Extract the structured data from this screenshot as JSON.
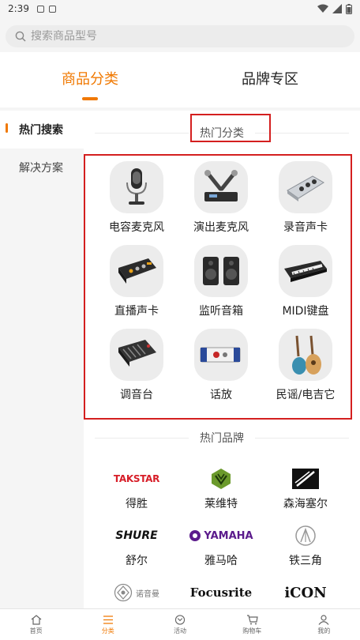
{
  "status_bar": {
    "time": "2:39"
  },
  "search": {
    "placeholder": "搜索商品型号"
  },
  "tabs": [
    {
      "label": "商品分类",
      "active": true
    },
    {
      "label": "品牌专区",
      "active": false
    }
  ],
  "sidebar": {
    "items": [
      {
        "label": "热门搜索",
        "active": true
      },
      {
        "label": "解决方案",
        "active": false
      }
    ]
  },
  "hot_categories": {
    "title": "热门分类",
    "items": [
      {
        "label": "电容麦克风",
        "icon": "condenser-mic-icon"
      },
      {
        "label": "演出麦克风",
        "icon": "wireless-mic-icon"
      },
      {
        "label": "录音声卡",
        "icon": "audio-interface-icon"
      },
      {
        "label": "直播声卡",
        "icon": "live-soundcard-icon"
      },
      {
        "label": "监听音箱",
        "icon": "monitor-speakers-icon"
      },
      {
        "label": "MIDI键盘",
        "icon": "midi-keyboard-icon"
      },
      {
        "label": "调音台",
        "icon": "mixer-icon"
      },
      {
        "label": "话放",
        "icon": "preamp-icon"
      },
      {
        "label": "民谣/电吉它",
        "icon": "guitar-icon"
      }
    ]
  },
  "hot_brands": {
    "title": "热门品牌",
    "items": [
      {
        "label": "得胜",
        "logo_text": "TAKSTAR",
        "color": "#d71e28"
      },
      {
        "label": "莱维特",
        "logo_text": "",
        "color": "#5b8c2a"
      },
      {
        "label": "森海塞尔",
        "logo_text": "",
        "color": "#111111"
      },
      {
        "label": "舒尔",
        "logo_text": "SHURE",
        "color": "#111111"
      },
      {
        "label": "雅马哈",
        "logo_text": "YAMAHA",
        "color": "#5b1b8c"
      },
      {
        "label": "铁三角",
        "logo_text": "",
        "color": "#888888"
      },
      {
        "label": "",
        "logo_text": "诺音曼",
        "color": "#777777"
      },
      {
        "label": "",
        "logo_text": "Focusrite",
        "color": "#111111"
      },
      {
        "label": "",
        "logo_text": "iCON",
        "color": "#111111"
      }
    ]
  },
  "bottom_nav": [
    {
      "label": "首页",
      "icon": "home-icon",
      "active": false
    },
    {
      "label": "分类",
      "icon": "category-list-icon",
      "active": true
    },
    {
      "label": "活动",
      "icon": "activity-icon",
      "active": false
    },
    {
      "label": "购物车",
      "icon": "cart-icon",
      "active": false
    },
    {
      "label": "我的",
      "icon": "profile-icon",
      "active": false
    }
  ],
  "accent_color": "#f07800",
  "highlight_color": "#d41f1f"
}
